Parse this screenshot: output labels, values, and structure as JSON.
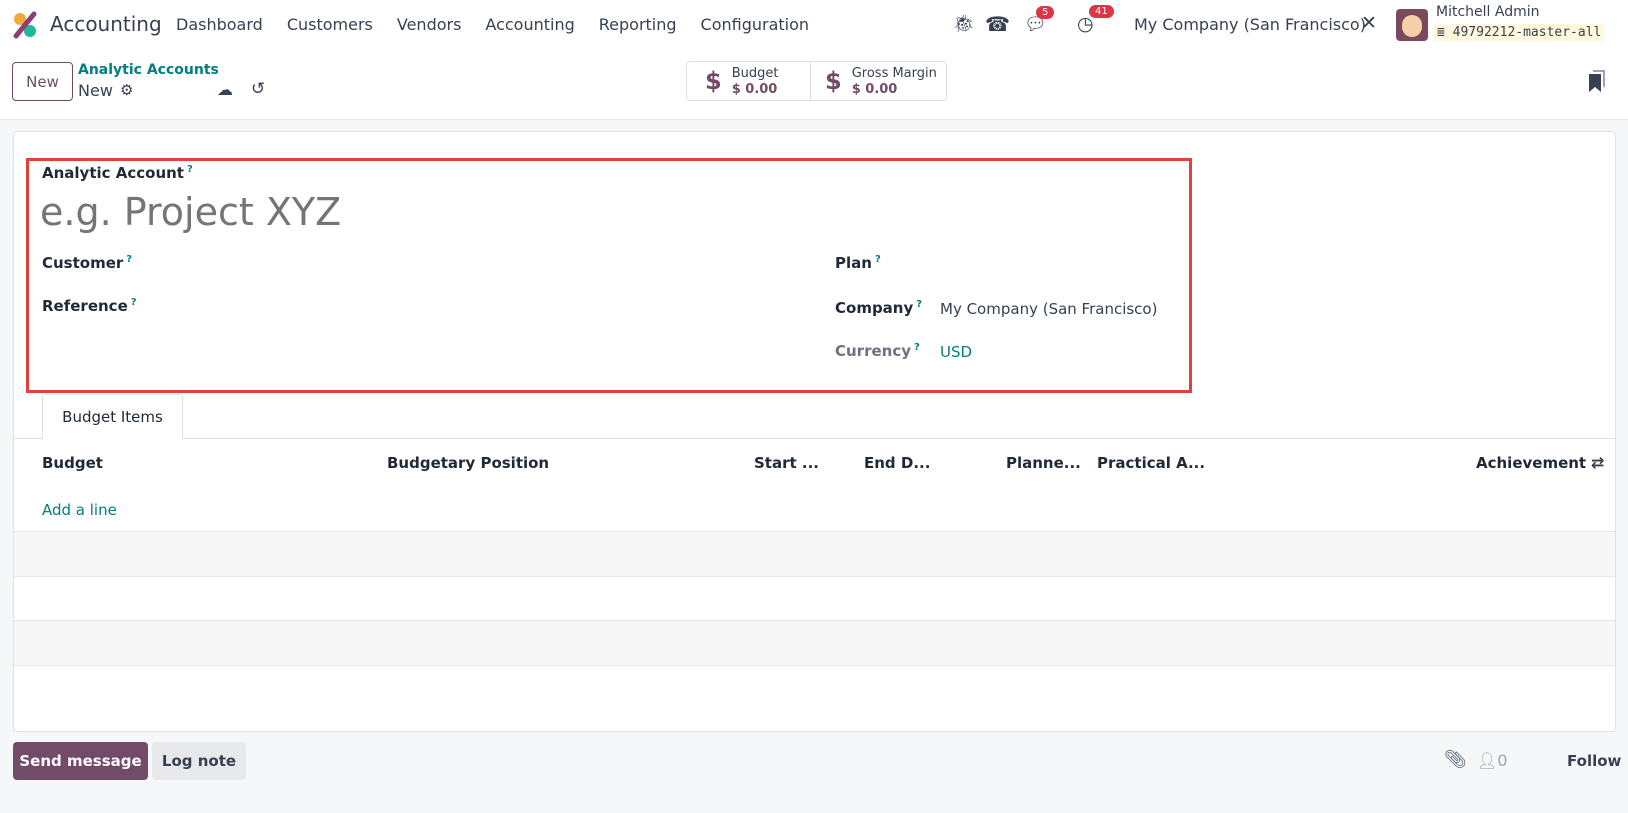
{
  "navbar": {
    "app_name": "Accounting",
    "menu": [
      "Dashboard",
      "Customers",
      "Vendors",
      "Accounting",
      "Reporting",
      "Configuration"
    ],
    "messages_count": "5",
    "activities_count": "41",
    "company": "My Company (San Francisco)",
    "user_name": "Mitchell Admin",
    "database": "49792212-master-all"
  },
  "control_panel": {
    "new_label": "New",
    "breadcrumb_parent": "Analytic Accounts",
    "record_name": "New",
    "stats": [
      {
        "label": "Budget",
        "value": "$ 0.00"
      },
      {
        "label": "Gross Margin",
        "value": "$ 0.00"
      }
    ]
  },
  "form": {
    "analytic_account_label": "Analytic Account",
    "name_placeholder": "e.g. Project XYZ",
    "help": "?",
    "customer_label": "Customer",
    "reference_label": "Reference",
    "plan_label": "Plan",
    "company_label": "Company",
    "company_value": "My Company (San Francisco)",
    "currency_label": "Currency",
    "currency_value": "USD"
  },
  "tabs": [
    {
      "label": "Budget Items",
      "active": true
    }
  ],
  "table": {
    "columns": [
      "Budget",
      "Budgetary Position",
      "Start ...",
      "End D...",
      "Planne...",
      "Practical A...",
      "Achievement"
    ],
    "add_line": "Add a line"
  },
  "chatter": {
    "send_message": "Send message",
    "log_note": "Log note",
    "followers_count": "0",
    "follow": "Follow"
  },
  "colors": {
    "brand": "#714b67",
    "link": "#017e84",
    "highlight": "#e0413a"
  }
}
